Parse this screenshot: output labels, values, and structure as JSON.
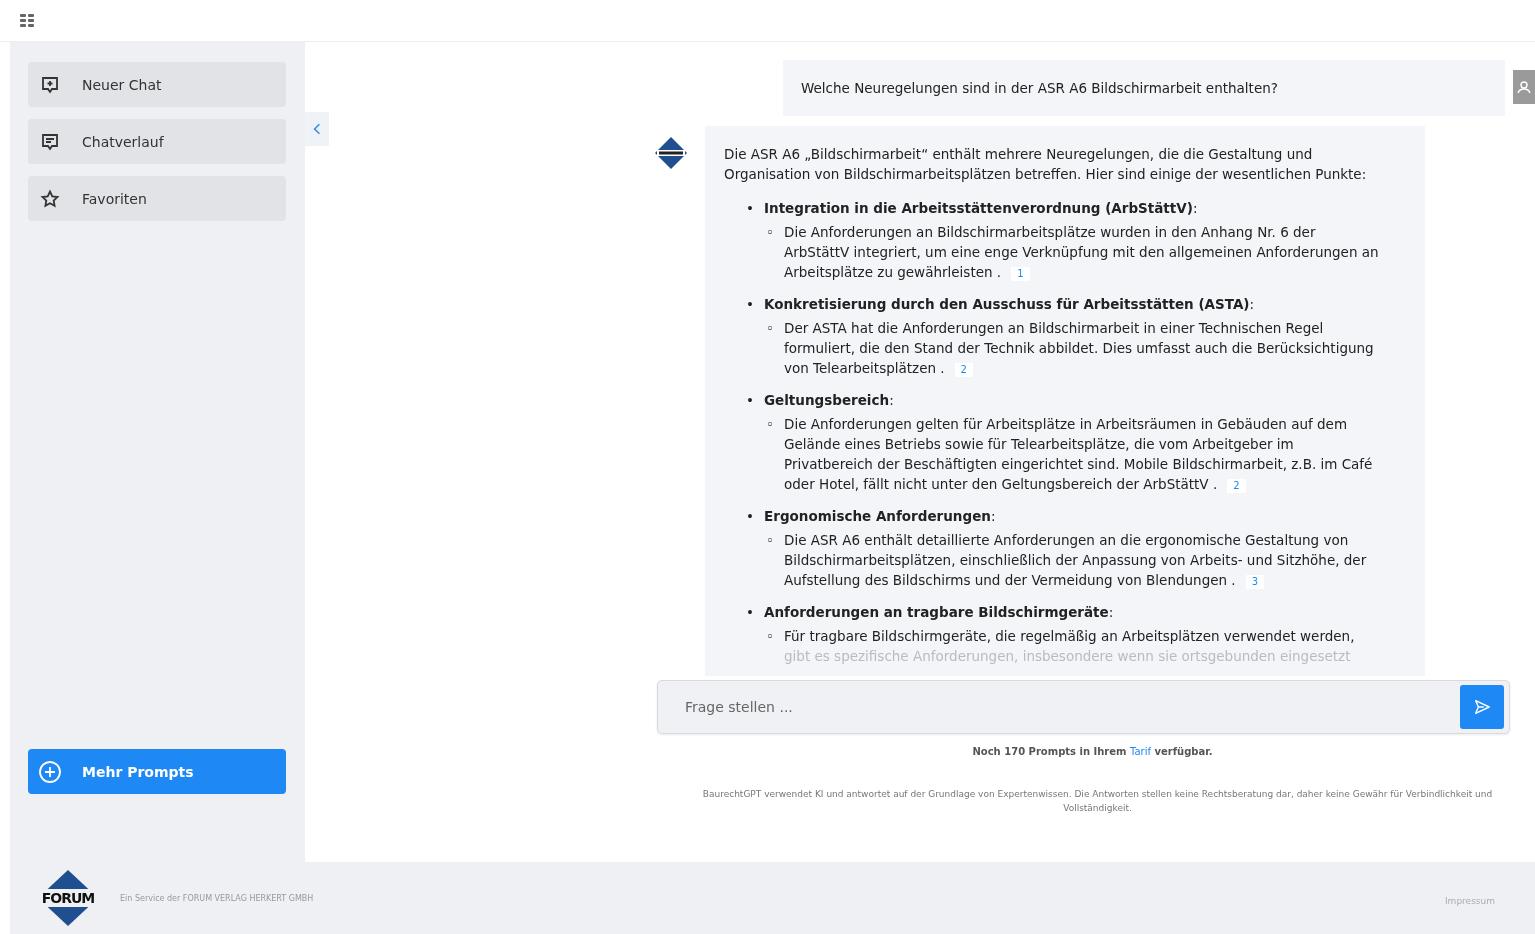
{
  "sidebar": {
    "items": [
      {
        "kind": "new-chat",
        "label": "Neuer Chat"
      },
      {
        "kind": "history",
        "label": "Chatverlauf"
      },
      {
        "kind": "favorites",
        "label": "Favoriten"
      }
    ],
    "more_prompts": "Mehr Prompts"
  },
  "chat": {
    "question": "Welche Neuregelungen sind in der ASR A6 Bildschirmarbeit enthalten?",
    "answer": {
      "intro": "Die ASR A6 „Bildschirmarbeit“ enthält mehrere Neuregelungen, die die Gestaltung und Organisation von Bildschirmarbeitsplätzen betreffen. Hier sind einige der wesentlichen Punkte:",
      "bullet": "•",
      "sub_bullet": "◦",
      "points": [
        {
          "title": "**Integration in die Arbeitsstättenverordnung (ArbStättV)**:",
          "text": "Die Anforderungen an Bildschirmarbeitsplätze wurden in den Anhang Nr. 6 der ArbStättV integriert, um eine enge Verknüpfung mit den allgemeinen Anforderungen an Arbeitsplätze zu gewährleisten .",
          "source": "1"
        },
        {
          "title": "**Konkretisierung durch den Ausschuss für Arbeitsstätten (ASTA)**:",
          "text": "Der ASTA hat die Anforderungen an Bildschirmarbeit in einer Technischen Regel formuliert, die den Stand der Technik abbildet. Dies umfasst auch die Berücksichtigung von Telearbeitsplätzen .",
          "source": "2"
        },
        {
          "title": "**Geltungsbereich**:",
          "text": "Die Anforderungen gelten für Arbeitsplätze in Arbeitsräumen in Gebäuden auf dem Gelände eines Betriebs sowie für Telearbeitsplätze, die vom Arbeitgeber im Privatbereich der Beschäftigten eingerichtet sind. Mobile Bildschirmarbeit, z.B. im Café oder Hotel, fällt nicht unter den Geltungsbereich der ArbStättV .",
          "source": "2"
        },
        {
          "title": "**Ergonomische Anforderungen**:",
          "text": "Die ASR A6 enthält detaillierte Anforderungen an die ergonomische Gestaltung von Bildschirmarbeitsplätzen, einschließlich der Anpassung von Arbeits- und Sitzhöhe, der Aufstellung des Bildschirms und der Vermeidung von Blendungen .",
          "source": "3"
        },
        {
          "title": "**Anforderungen an tragbare Bildschirmgeräte**:",
          "text": "Für tragbare Bildschirmgeräte, die regelmäßig an Arbeitsplätzen verwendet werden,",
          "faded_text": "gibt es spezifische Anforderungen, insbesondere wenn sie ortsgebunden eingesetzt"
        }
      ]
    },
    "input": {
      "placeholder": "Frage stellen ..."
    },
    "quota": {
      "before": "Noch 170 Prompts in Ihrem",
      "link": "Tarif",
      "after": "verfügbar."
    },
    "disclaimer": "BaurechtGPT verwendet KI und antwortet auf der Grundlage von Expertenwissen. Die Antworten stellen keine Rechtsberatung dar, daher keine Gewähr für Verbindlichkeit und Vollständigkeit."
  },
  "footer": {
    "logo_text": "FORUM",
    "service": "Ein Service der FORUM VERLAG HERKERT GMBH",
    "links": [
      "Impressum"
    ]
  }
}
